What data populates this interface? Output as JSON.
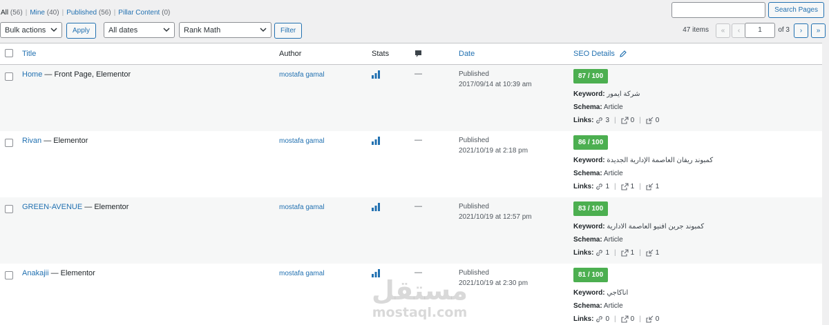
{
  "views": [
    {
      "label": "All",
      "count": "(56)",
      "current": true
    },
    {
      "label": "Mine",
      "count": "(40)"
    },
    {
      "label": "Published",
      "count": "(56)"
    },
    {
      "label": "Pillar Content",
      "count": "(0)"
    }
  ],
  "search": {
    "button": "Search Pages",
    "value": ""
  },
  "bulk": {
    "selected": "Bulk actions",
    "apply": "Apply"
  },
  "dates_filter": "All dates",
  "seo_filter": "Rank Math",
  "filter_button": "Filter",
  "pagination": {
    "items": "47 items",
    "first": "«",
    "prev": "‹",
    "current": "1",
    "of": "of 3",
    "next": "›",
    "last": "»"
  },
  "columns": {
    "title": "Title",
    "author": "Author",
    "stats": "Stats",
    "date": "Date",
    "seo": "SEO Details"
  },
  "rows": [
    {
      "title": "Home",
      "states": "— Front Page, Elementor",
      "author": "mostafa gamal",
      "comments": "—",
      "status": "Published",
      "date": "2017/09/14 at 10:39 am",
      "score": "87 / 100",
      "keyword": "شركة ايمور",
      "schema": "Article",
      "links": [
        "3",
        "0",
        "0"
      ]
    },
    {
      "title": "Rivan",
      "states": "— Elementor",
      "author": "mostafa gamal",
      "comments": "—",
      "status": "Published",
      "date": "2021/10/19 at 2:18 pm",
      "score": "86 / 100",
      "keyword": "كمبوند ريفان العاصمة الإدارية الجديدة",
      "schema": "Article",
      "links": [
        "1",
        "1",
        "1"
      ]
    },
    {
      "title": "GREEN-AVENUE",
      "states": "— Elementor",
      "author": "mostafa gamal",
      "comments": "—",
      "status": "Published",
      "date": "2021/10/19 at 12:57 pm",
      "score": "83 / 100",
      "keyword": "كمبوند جرين افنيو العاصمة الادارية",
      "schema": "Article",
      "links": [
        "1",
        "1",
        "1"
      ]
    },
    {
      "title": "Anakajii",
      "states": "— Elementor",
      "author": "mostafa gamal",
      "comments": "—",
      "status": "Published",
      "date": "2021/10/19 at 2:30 pm",
      "score": "81 / 100",
      "keyword": "اناكاجي",
      "schema": "Article",
      "links": [
        "0",
        "0",
        "0"
      ]
    }
  ],
  "seo_labels": {
    "keyword": "Keyword:",
    "schema": "Schema:",
    "links": "Links:"
  },
  "watermark": {
    "arabic": "مستقل",
    "latin": "mostaql.com"
  },
  "colors": {
    "link": "#2271b1",
    "score_good": "#4caf50"
  }
}
